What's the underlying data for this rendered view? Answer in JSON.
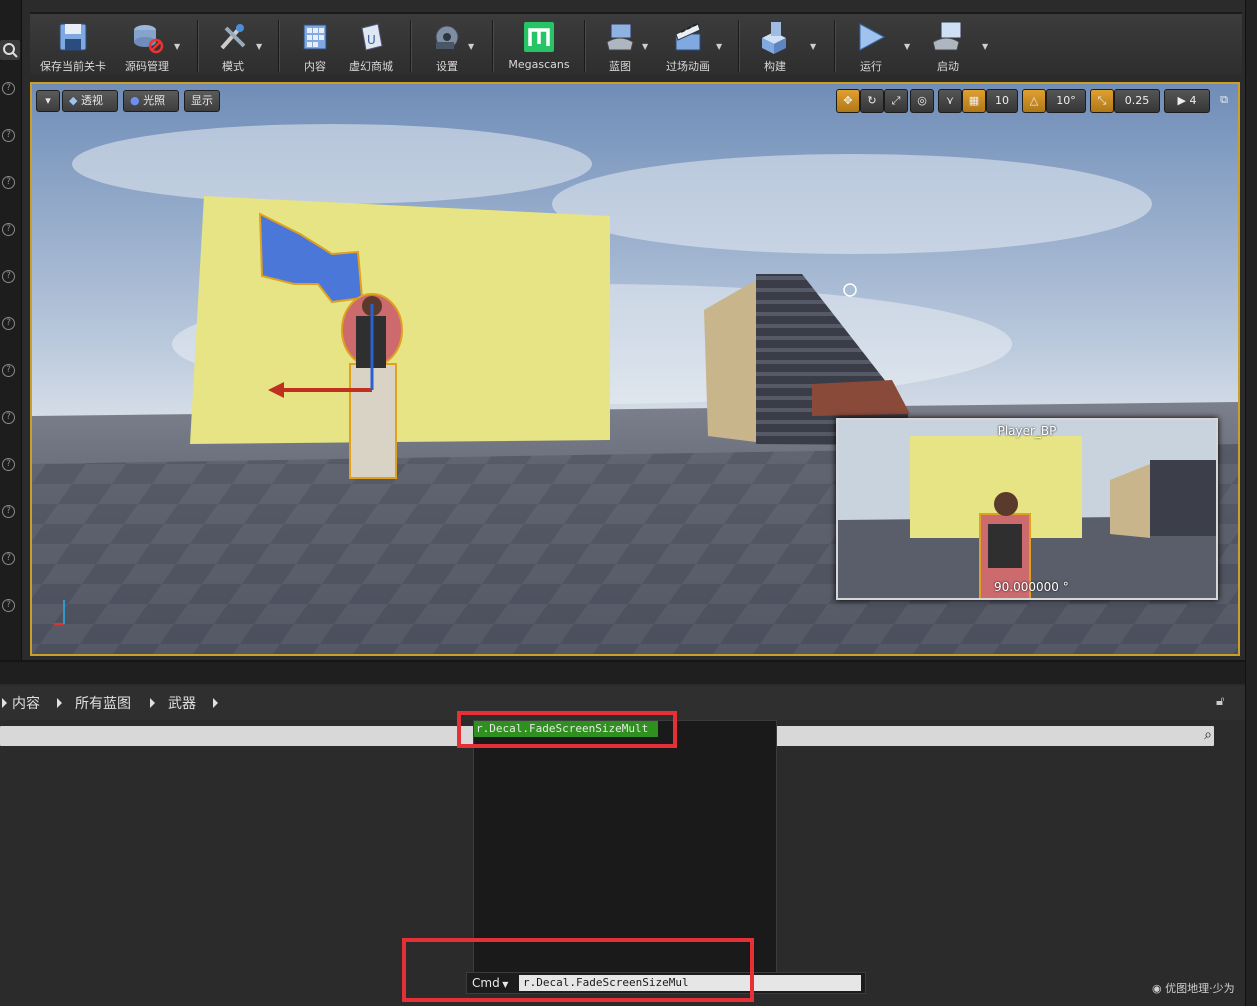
{
  "toolbar": {
    "items": [
      {
        "label": "保存当前关卡",
        "icon": "save-icon"
      },
      {
        "label": "源码管理",
        "icon": "source-control-icon"
      },
      {
        "label": "模式",
        "icon": "modes-icon"
      },
      {
        "label": "内容",
        "icon": "content-icon"
      },
      {
        "label": "虚幻商城",
        "icon": "marketplace-icon"
      },
      {
        "label": "设置",
        "icon": "settings-icon"
      },
      {
        "label": "Megascans",
        "icon": "megascans-icon"
      },
      {
        "label": "蓝图",
        "icon": "blueprints-icon"
      },
      {
        "label": "过场动画",
        "icon": "cinematics-icon"
      },
      {
        "label": "构建",
        "icon": "build-icon"
      },
      {
        "label": "运行",
        "icon": "play-icon"
      },
      {
        "label": "启动",
        "icon": "launch-icon"
      }
    ]
  },
  "viewport": {
    "options_menu": "▾",
    "perspective": "透视",
    "lighting": "光照",
    "show": "显示",
    "grid_snap": "10",
    "rotation_snap": "10°",
    "scale_snap": "0.25",
    "camera_speed": "4"
  },
  "preview": {
    "title": "Player_BP",
    "angle": "90.000000 °"
  },
  "breadcrumb": {
    "items": [
      "内容",
      "所有蓝图",
      "武器"
    ]
  },
  "console": {
    "suggestion": "r.Decal.FadeScreenSizeMult",
    "cmd_label": "Cmd",
    "input_value": "r.Decal.FadeScreenSizeMul"
  },
  "watermark": "优图地理·少为",
  "colors": {
    "accent": "#c8a02a",
    "highlight_box": "#e63038",
    "suggestion_bg": "#2f8f1f"
  }
}
